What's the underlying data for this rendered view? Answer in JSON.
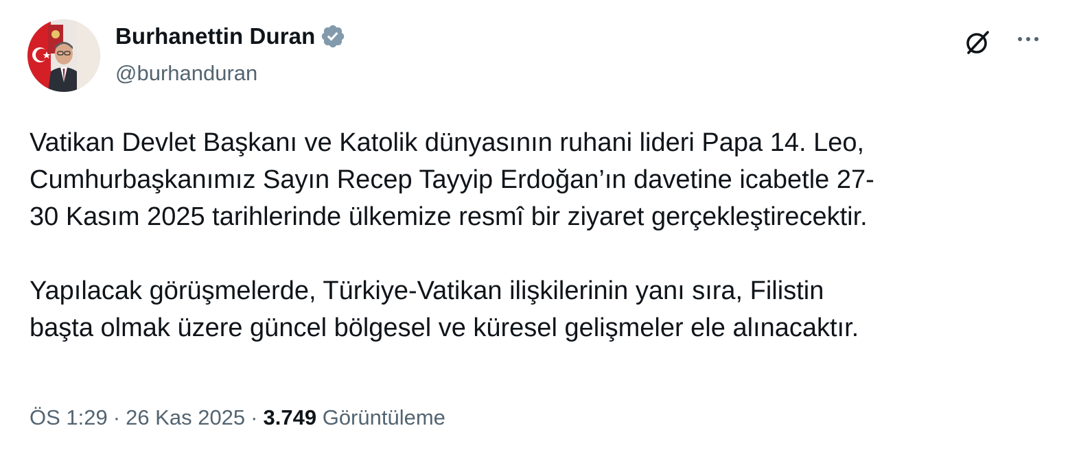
{
  "author": {
    "display_name": "Burhanettin Duran",
    "handle": "@burhanduran",
    "verified": true,
    "verified_badge_color": "#829aab"
  },
  "icons": {
    "avatar": "profile-photo",
    "verified": "verified-badge-icon",
    "grok": "grok-icon",
    "more": "more-options-icon"
  },
  "tweet": {
    "paragraph1_lines": [
      "Vatikan Devlet Başkanı ve Katolik dünyasının ruhani lideri Papa 14. Leo,",
      "Cumhurbaşkanımız Sayın Recep Tayyip Erdoğan’ın davetine icabetle 27-",
      "30 Kasım 2025 tarihlerinde ülkemize resmî bir ziyaret gerçekleştirecektir."
    ],
    "paragraph2_lines": [
      "Yapılacak görüşmelerde, Türkiye-Vatikan ilişkilerinin yanı sıra, Filistin",
      "başta olmak üzere güncel bölgesel ve küresel gelişmeler ele alınacaktır."
    ]
  },
  "meta": {
    "time": "ÖS 1:29",
    "separator": "·",
    "date": "26 Kas 2025",
    "views_count": "3.749",
    "views_label": "Görüntüleme"
  },
  "colors": {
    "text_primary": "#0f1419",
    "text_secondary": "#536471",
    "background": "#ffffff"
  }
}
